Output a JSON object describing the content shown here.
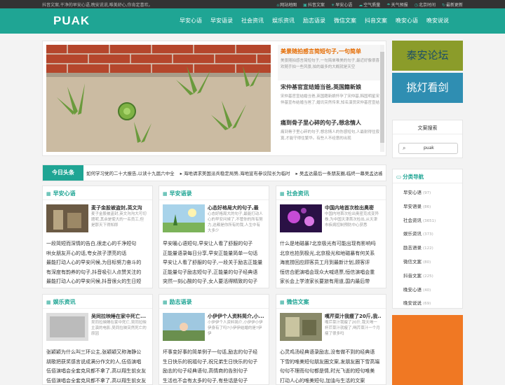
{
  "topbar": {
    "text": "抖音文案,干净的早安心语,晚安说说,唯美舒心,你肯定喜欢。",
    "links": [
      "网站地图",
      "抖音文案",
      "早安心语",
      "空气质量",
      "天气预报",
      "北京时间",
      "最新更新"
    ]
  },
  "header": {
    "logo": "PUAK",
    "nav": [
      "早安心语",
      "早安语录",
      "社会资讯",
      "娱乐资讯",
      "励志语录",
      "微信文案",
      "抖音文案",
      "晚安心语",
      "晚安说说"
    ]
  },
  "slider": {
    "items": [
      {
        "title": "美景随拍感言简短句子,一句简单",
        "desc": "美景随拍感言简短句子,一句简单唯美的句子,最近好像很喜欢随手拍一些风景,拍的最多的大概就是天空"
      },
      {
        "title": "宋仲基官宣结婚当爸,英国籍新娘",
        "desc": "宋仲基官宣结婚当爸,英国籍新娘怀孕了宋仲基,韩国明星宋仲基宣布结婚当爸了,婚讯突然传来,知名演员宋仲基官宣结婚当爸,一时间"
      },
      {
        "title": "痛到骨子里心碎的句子,想念情人",
        "desc": "痛到骨子里心碎的句子,想念情人的伤感短句,人最耐得住寂寞,才能守得住繁华。有些人不经意的出现"
      }
    ]
  },
  "ticker": {
    "label": "今日头条",
    "items": [
      "如何学习党的二十大报告,以读十九届六中全",
      "海地请求美国派兵稳定局势,海地宣布参议院长为临时",
      "吴孟达最后一条朋友圈,临终一幕吴孟达被泼新水"
    ]
  },
  "boxes": [
    {
      "title": "早安心语",
      "feat_title": "麦子金股被盗封,英文沟",
      "feat_desc": "麦子金股被盗封,英文沟沟大可切题呢,其余是使大的一名员工,但是那天下得知即",
      "items": [
        "一段简短而深情的告白,很走心的千净短句",
        "哄女朋友开心的话,夸女孩子漂亮的话",
        "最能打动人心的早安问候,为目标努力奋斗的",
        "有深度有韵养的句子,抖音吸引人点赞关注的",
        "最能打动人心的早安问候,抖音很火的生日短"
      ]
    },
    {
      "title": "早安语录",
      "feat_title": "心态好格局大的句子,最",
      "feat_desc": "心态好格局大的句子,最能打动人心的早安问候了,不管你的所有努力,这都是你所有的我,人生中有大多少",
      "items": [
        "早安暖心语短句,早安让人看了舒服的句子",
        "正能量语录每日分享,早安正能量简单一句话",
        "早安让人看了舒服的句子,一段关于励志正能量",
        "正能量句子励志短句子,正能量的句子经典语",
        "突然一刻心酸的句子,女人要活得精致的句子"
      ]
    },
    {
      "title": "社会资讯",
      "feat_title": "中国内地首次检出奥密",
      "feat_desc": "中国内地首次检出奥密克戎变异株,为中国天津首次检出,从天津市疾病控制预防中心获悉",
      "items": [
        "什么是地磁暴?北京极光有可能出现有影响吗",
        "北京也拍到极光,北京极光和地磁暴有何关系",
        "海底捞回应顾客员工月到最新计划,顾客评",
        "恒信合肥演唱会现众大喊退票,恒信演唱会重",
        "家长会上学渣家长要旅有用道,国内最后带"
      ]
    },
    {
      "title": "娱乐资讯",
      "feat_title": "吴同拉映睡在家中死亡...",
      "feat_desc": "吴同拉映睡在家中死亡,吴同拉映主演的电影,吴同拉映突然死亡的原因",
      "items": [
        "张颖颖为什么叫三环公主,张颖颖又称海静公",
        "胡歌把获奖感言说成满分作文的人,伍佰演唱",
        "伍佰演唱会全套克风都不拿了,高以翔生前女友",
        "伍佰演唱会全套克风都不拿了,高以翔生前女友"
      ]
    },
    {
      "title": "励志语录",
      "feat_title": "小伊伊个人资料简介,小...",
      "feat_desc": "小伊伊个人资料简介,小伊伊小伊伊身有了吗?小伊伊结婚的是?伊伊",
      "items": [
        "坏事变好事的简单例子一句话,励志的句子经",
        "生日快乐的祝福句子,祝兄弟生日快乐的句子",
        "励志的句子经典语句,高情商的告别句子",
        "生活也不会有太多的句子,有些话是句子"
      ]
    },
    {
      "title": "微信文案",
      "feat_title": "嘴芹菜汁我瘦了20斤,我...",
      "feat_desc": "嘴芹菜汁我瘦了20斤,我天喝一杯芹菜汁就瘦了,喝芹菜汁一个月瘦了很多吗",
      "items": [
        "心灵鸡汤经典语录励志,没有做不到的经典语",
        "下雪的唯美短句朋友圈文案,发朋友圈下雪高端",
        "句句不理而句句都是情,时光飞逝的短句唯美",
        "打动人心的唯美短句,加油与生活的文案"
      ]
    }
  ],
  "aside": {
    "ad1": "泰安论坛",
    "ad2": "挑灯看剑",
    "search_title": "文案搜索",
    "search_value": "puak",
    "cat_title": "分类导航",
    "cats": [
      {
        "name": "早安心语",
        "count": "(97)"
      },
      {
        "name": "早安语录",
        "count": "(86)"
      },
      {
        "name": "社会资讯",
        "count": "(3651)"
      },
      {
        "name": "娱乐资讯",
        "count": "(373)"
      },
      {
        "name": "励志语录",
        "count": "(122)"
      },
      {
        "name": "微信文案",
        "count": "(80)"
      },
      {
        "name": "抖音文案",
        "count": "(225)"
      },
      {
        "name": "晚安心语",
        "count": "(40)"
      },
      {
        "name": "晚安说说",
        "count": "(69)"
      }
    ]
  }
}
